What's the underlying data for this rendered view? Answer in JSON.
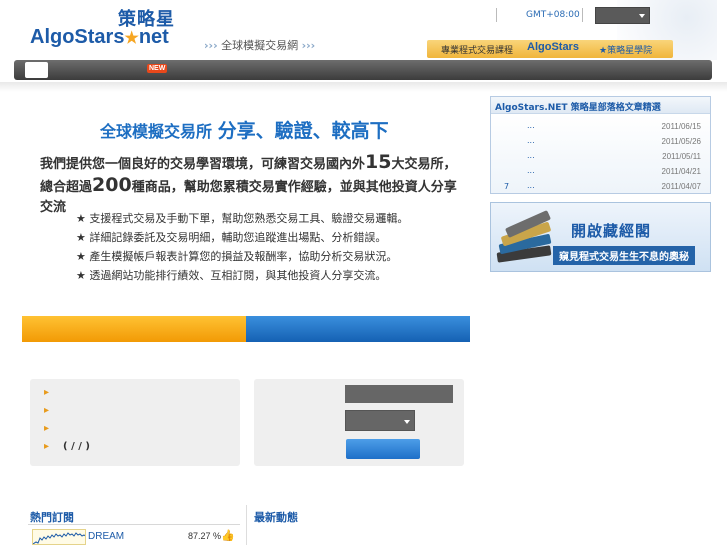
{
  "header": {
    "logo_zh": "策略星",
    "logo_en": "AlgoStars",
    "logo_star": "★",
    "logo_net": "net",
    "slogan_arrows_left": "›››",
    "slogan": "全球模擬交易網",
    "slogan_arrows_right": "›››",
    "timezone": "GMT+08:00",
    "promo": {
      "label": "專業程式交易課程",
      "brand": "AlgoStars",
      "suffix": "★策略星學院"
    }
  },
  "nav": {
    "new_badge": "NEW"
  },
  "hero": {
    "title": "全球模擬交易所",
    "title_big": "分享、驗證、較高下",
    "intro_part1": "我們提供您一個良好的交易學習環境，可練習交易國內外",
    "intro_num1": "15",
    "intro_part2": "大交易所，總合超過",
    "intro_num2": "200",
    "intro_part3": "種商品，幫助您累積交易實作經驗，並與其他投資人分享交流",
    "features": [
      "★ 支援程式交易及手動下單，幫助您熟悉交易工具、驗證交易邏輯。",
      "★ 詳細記錄委託及交易明細，輔助您追蹤進出場點、分析錯誤。",
      "★ 產生模擬帳戶報表計算您的損益及報酬率，協助分析交易狀況。",
      "★ 透過網站功能排行績效、互相訂閱，與其他投資人分享交流。"
    ]
  },
  "left_panel": {
    "bullet": "▸",
    "last_row_text": "(   /   /   )"
  },
  "bottom": {
    "hot_title": "熱門訂閱",
    "news_title": "最新動態",
    "hot_items": [
      {
        "name": "DREAM",
        "pct": "87.27 %",
        "icon": "thumbs-up-icon"
      }
    ]
  },
  "blog": {
    "title": "AlgoStars.NET 策略星部落格文章精選",
    "rows": [
      {
        "idx": "",
        "dots": "...",
        "date": "2011/06/15"
      },
      {
        "idx": "",
        "dots": "...",
        "date": "2011/05/26"
      },
      {
        "idx": "",
        "dots": "...",
        "date": "2011/05/11"
      },
      {
        "idx": "",
        "dots": "...",
        "date": "2011/04/21"
      },
      {
        "idx": "7",
        "dots": "...",
        "date": "2011/04/07"
      }
    ]
  },
  "banner": {
    "title": "開啟藏經閣",
    "subtitle": "窺見程式交易生生不息的奧秘"
  },
  "colors": {
    "brand_blue": "#1d5ba8",
    "tab_orange": "#f29a05",
    "tab_blue": "#1561b3",
    "nav_dark": "#3c3c3c"
  }
}
